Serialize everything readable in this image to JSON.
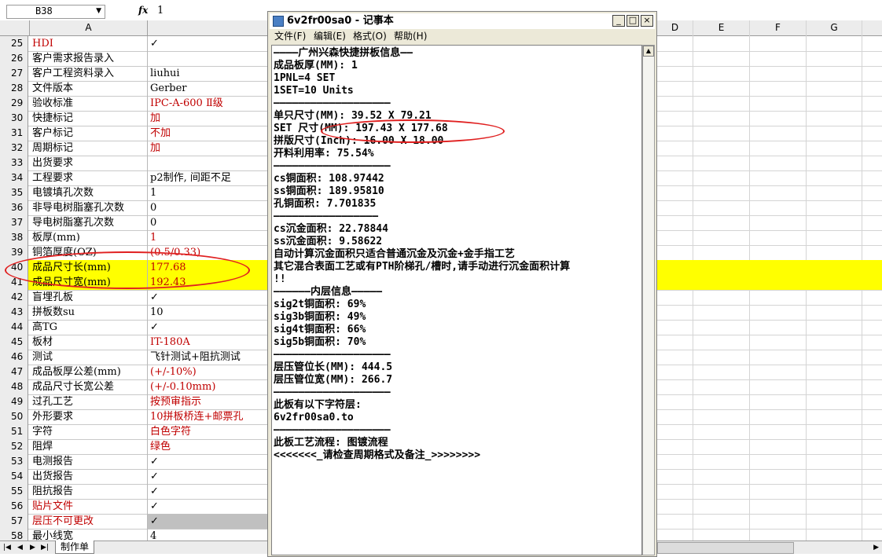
{
  "spreadsheet": {
    "name_box": "B38",
    "fx_label": "fx",
    "formula_value": "1",
    "columns": [
      "A",
      "D",
      "E",
      "F",
      "G"
    ],
    "rows": [
      {
        "num": "25",
        "a": "HDI",
        "b": "✓",
        "a_red": true
      },
      {
        "num": "26",
        "a": "客户需求报告录入",
        "b": ""
      },
      {
        "num": "27",
        "a": "客户工程资料录入",
        "b": "liuhui"
      },
      {
        "num": "28",
        "a": "文件版本",
        "b": "Gerber"
      },
      {
        "num": "29",
        "a": "验收标准",
        "b": "IPC-A-600 Ⅱ级",
        "b_red": true
      },
      {
        "num": "30",
        "a": "快捷标记",
        "b": "加",
        "b_red": true
      },
      {
        "num": "31",
        "a": "客户标记",
        "b": "不加",
        "b_red": true
      },
      {
        "num": "32",
        "a": "周期标记",
        "b": "加",
        "b_red": true
      },
      {
        "num": "33",
        "a": "出货要求",
        "b": ""
      },
      {
        "num": "34",
        "a": "工程要求",
        "b": "p2制作, 间距不足"
      },
      {
        "num": "35",
        "a": "电镀填孔次数",
        "b": "1"
      },
      {
        "num": "36",
        "a": "非导电树脂塞孔次数",
        "b": "0"
      },
      {
        "num": "37",
        "a": "导电树脂塞孔次数",
        "b": "0"
      },
      {
        "num": "38",
        "a": "板厚(mm)",
        "b": "1",
        "b_red": true
      },
      {
        "num": "39",
        "a": "铜箔厚度(OZ)",
        "b": "(0.5/0.33)",
        "b_red": true
      },
      {
        "num": "40",
        "a": "成品尺寸长(mm)",
        "b": "177.68",
        "b_red": true,
        "highlight": true
      },
      {
        "num": "41",
        "a": "成品尺寸宽(mm)",
        "b": "192.43",
        "b_red": true,
        "highlight": true
      },
      {
        "num": "42",
        "a": "盲埋孔板",
        "b": "✓"
      },
      {
        "num": "43",
        "a": "拼板数su",
        "b": "10"
      },
      {
        "num": "44",
        "a": "高TG",
        "b": "✓"
      },
      {
        "num": "45",
        "a": "板材",
        "b": "IT-180A",
        "b_red": true
      },
      {
        "num": "46",
        "a": "测试",
        "b": "飞针测试+阻抗测试"
      },
      {
        "num": "47",
        "a": "成品板厚公差(mm)",
        "b": "(+/-10%)",
        "b_red": true
      },
      {
        "num": "48",
        "a": "成品尺寸长宽公差",
        "b": "(+/-0.10mm)",
        "b_red": true
      },
      {
        "num": "49",
        "a": "过孔工艺",
        "b": "按预审指示",
        "b_red": true
      },
      {
        "num": "50",
        "a": "外形要求",
        "b": "10拼板桥连+邮票孔",
        "b_red": true
      },
      {
        "num": "51",
        "a": "字符",
        "b": "白色字符",
        "b_red": true
      },
      {
        "num": "52",
        "a": "阻焊",
        "b": "绿色",
        "b_red": true
      },
      {
        "num": "53",
        "a": "电测报告",
        "b": "✓"
      },
      {
        "num": "54",
        "a": "出货报告",
        "b": "✓"
      },
      {
        "num": "55",
        "a": "阻抗报告",
        "b": "✓"
      },
      {
        "num": "56",
        "a": "贴片文件",
        "b": "✓",
        "a_red": true
      },
      {
        "num": "57",
        "a": "层压不可更改",
        "b": "✓",
        "a_red": true,
        "b_gray": true
      },
      {
        "num": "58",
        "a": "最小线宽",
        "b": "4"
      }
    ],
    "sheet_tab": "制作单",
    "colors": {
      "highlight": "#ffff00",
      "red_text": "#c00000"
    }
  },
  "notepad": {
    "title": "6v2fr00sa0 - 记事本",
    "menus": [
      "文件(F)",
      "编辑(E)",
      "格式(O)",
      "帮助(H)"
    ],
    "buttons": [
      "_",
      "□",
      "×"
    ],
    "lines": [
      "————广州兴森快捷拼板信息——",
      "成品板厚(MM): 1",
      "1PNL=4 SET",
      "1SET=10 Units",
      "———————————————————",
      "单只尺寸(MM): 39.52 X 79.21",
      "SET 尺寸(MM): 197.43 X 177.68",
      "拼版尺寸(Inch): 16.00 X 18.00",
      "开料利用率: 75.54%",
      "———————————————————",
      "cs铜面积: 108.97442",
      "ss铜面积: 189.95810",
      "孔铜面积: 7.701835",
      "—————————————————",
      "cs沉金面积: 22.78844",
      "ss沉金面积: 9.58622",
      "自动计算沉金面积只适合普通沉金及沉金+金手指工艺",
      "其它混合表面工艺或有PTH阶梯孔/槽时,请手动进行沉金面积计算",
      "!!",
      "——————内层信息—————",
      "sig2t铜面积: 69%",
      "sig3b铜面积: 49%",
      "sig4t铜面积: 66%",
      "sig5b铜面积: 70%",
      "———————————————————",
      "层压管位长(MM): 444.5",
      "层压管位宽(MM): 266.7",
      "———————————————————",
      "此板有以下字符层:",
      "6v2fr00sa0.to",
      "———————————————————",
      "此板工艺流程: 图镀流程",
      "<<<<<<<_请检查周期格式及备注_>>>>>>>>"
    ]
  }
}
